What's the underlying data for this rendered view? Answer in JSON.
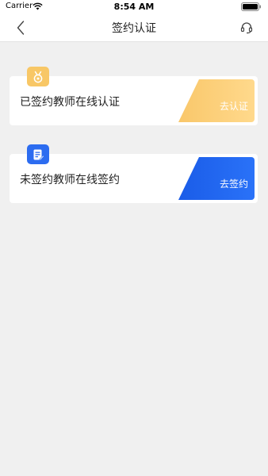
{
  "status_bar": {
    "carrier": "Carrier",
    "time": "8:54 AM"
  },
  "nav": {
    "title": "签约认证"
  },
  "cards": [
    {
      "label": "已签约教师在线认证",
      "action": "去认证",
      "badge_icon": "medal-icon",
      "accent": "#f8c766"
    },
    {
      "label": "未签约教师在线签约",
      "action": "去签约",
      "badge_icon": "document-edit-icon",
      "accent": "#1f64f2"
    }
  ]
}
